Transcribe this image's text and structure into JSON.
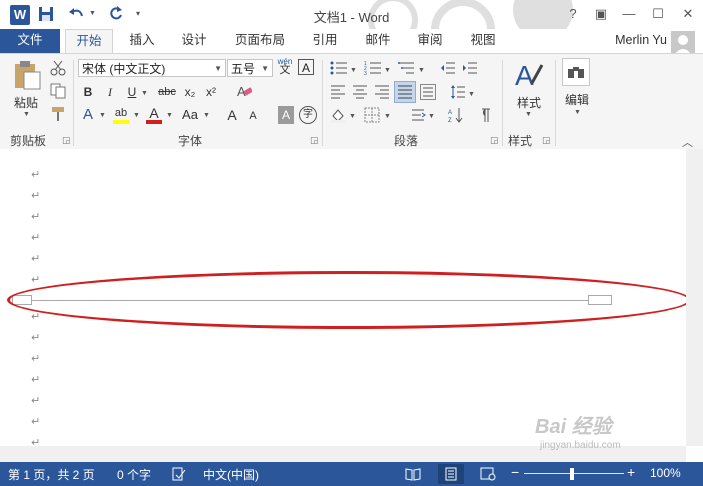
{
  "window": {
    "title": "文档1 - Word",
    "controls": [
      "?",
      "▣",
      "—",
      "☐",
      "✕"
    ]
  },
  "quick_access": {
    "logo": "W",
    "icons": [
      "save-icon",
      "undo-icon",
      "redo-icon",
      "customize-icon"
    ]
  },
  "tabs": [
    {
      "label": "文件"
    },
    {
      "label": "开始"
    },
    {
      "label": "插入"
    },
    {
      "label": "设计"
    },
    {
      "label": "页面布局"
    },
    {
      "label": "引用"
    },
    {
      "label": "邮件"
    },
    {
      "label": "审阅"
    },
    {
      "label": "视图"
    }
  ],
  "user": {
    "name": "Merlin Yu"
  },
  "ribbon": {
    "clipboard": {
      "label": "剪贴板",
      "paste": "粘贴"
    },
    "font": {
      "label": "字体",
      "font_name": "宋体 (中文正文)",
      "font_size": "五号",
      "wen": "wén",
      "wen_char": "文",
      "a_box": "A",
      "bold": "B",
      "italic": "I",
      "underline": "U",
      "strike": "abc",
      "sub": "x₂",
      "sup": "x²",
      "text_effect": "A",
      "highlight": "ab",
      "font_color": "A",
      "case": "Aa",
      "grow": "A",
      "shrink": "A",
      "char_shade": "A",
      "enclose": "字"
    },
    "paragraph": {
      "label": "段落"
    },
    "styles": {
      "label": "样式",
      "button": "样式"
    },
    "editing": {
      "label": "",
      "button": "编辑"
    }
  },
  "document": {
    "para_mark": "↵"
  },
  "status": {
    "page": "第 1 页，共 2 页",
    "words": "0 个字",
    "lang": "中文(中国)",
    "zoom": "100%",
    "zoom_minus": "−",
    "zoom_plus": "+"
  },
  "watermark": {
    "text": "Bai 经验",
    "sub": "jingyan.baidu.com"
  }
}
